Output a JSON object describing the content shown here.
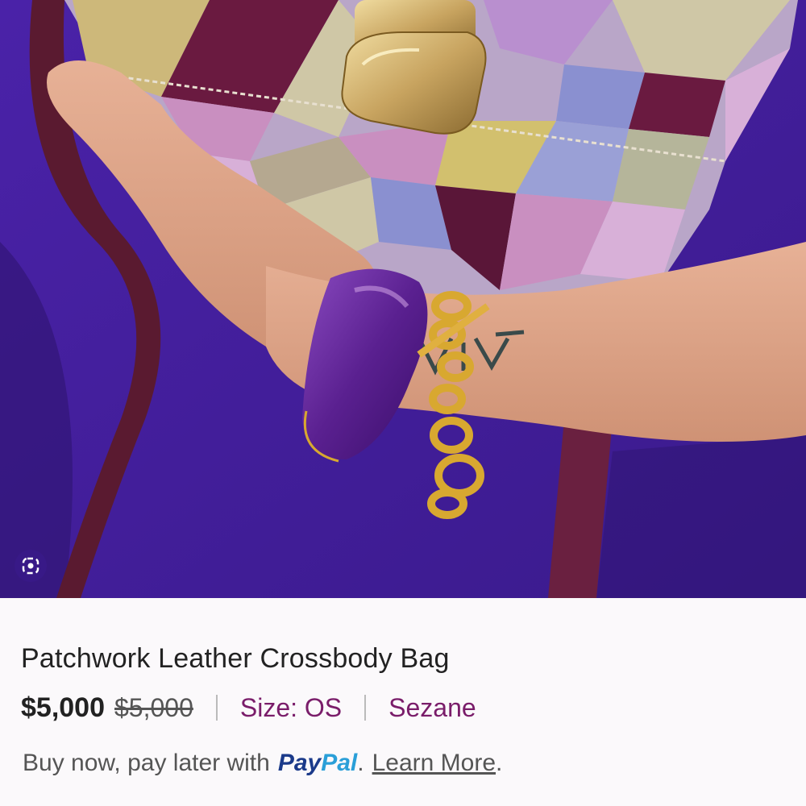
{
  "product": {
    "title": "Patchwork Leather Crossbody Bag",
    "price": "$5,000",
    "original_price": "$5,000",
    "size": "Size: OS",
    "brand": "Sezane"
  },
  "paypal": {
    "prefix": "Buy now, pay later with",
    "logo_part1": "Pay",
    "logo_part2": "Pal",
    "period1": ".",
    "link": "Learn More",
    "period2": "."
  },
  "image": {
    "lens_icon": "lens-icon",
    "colors": {
      "background_purple": "#3a1a8c",
      "bangle": "#6a2a9a",
      "chain": "#d8a830",
      "clasp": "#c8a460"
    }
  }
}
